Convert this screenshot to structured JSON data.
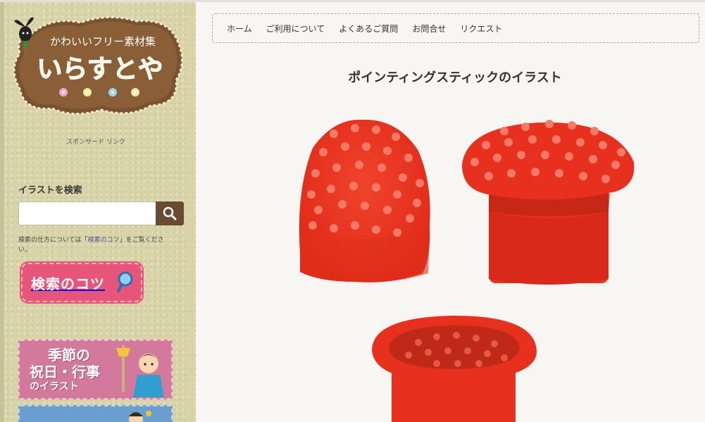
{
  "site": {
    "logo_small_text": "かわいいフリー素材集",
    "logo_name": "いらすとや"
  },
  "sidebar": {
    "sponsor_label": "スポンサード リンク",
    "search_heading": "イラストを検索",
    "search_value": "",
    "search_placeholder": "",
    "search_note_before": "検索の仕方については「",
    "search_note_link": "検索のコツ",
    "search_note_after": "」をご覧ください。",
    "tips_banner": "検索のコツ",
    "banner_seasons_line1": "季節の",
    "banner_seasons_line2": "祝日・行事",
    "banner_seasons_line3": "のイラスト"
  },
  "nav": {
    "items": [
      "ホーム",
      "ご利用について",
      "よくあるご質問",
      "お問合せ",
      "リクエスト"
    ]
  },
  "post": {
    "title": "ポインティングスティックのイラスト"
  },
  "colors": {
    "sidebar_bg": "#d9d3a8",
    "logo_brown": "#7a5230",
    "search_button": "#6a4a30",
    "stick_red": "#e8301e",
    "tips_pink": "#e8557a"
  }
}
